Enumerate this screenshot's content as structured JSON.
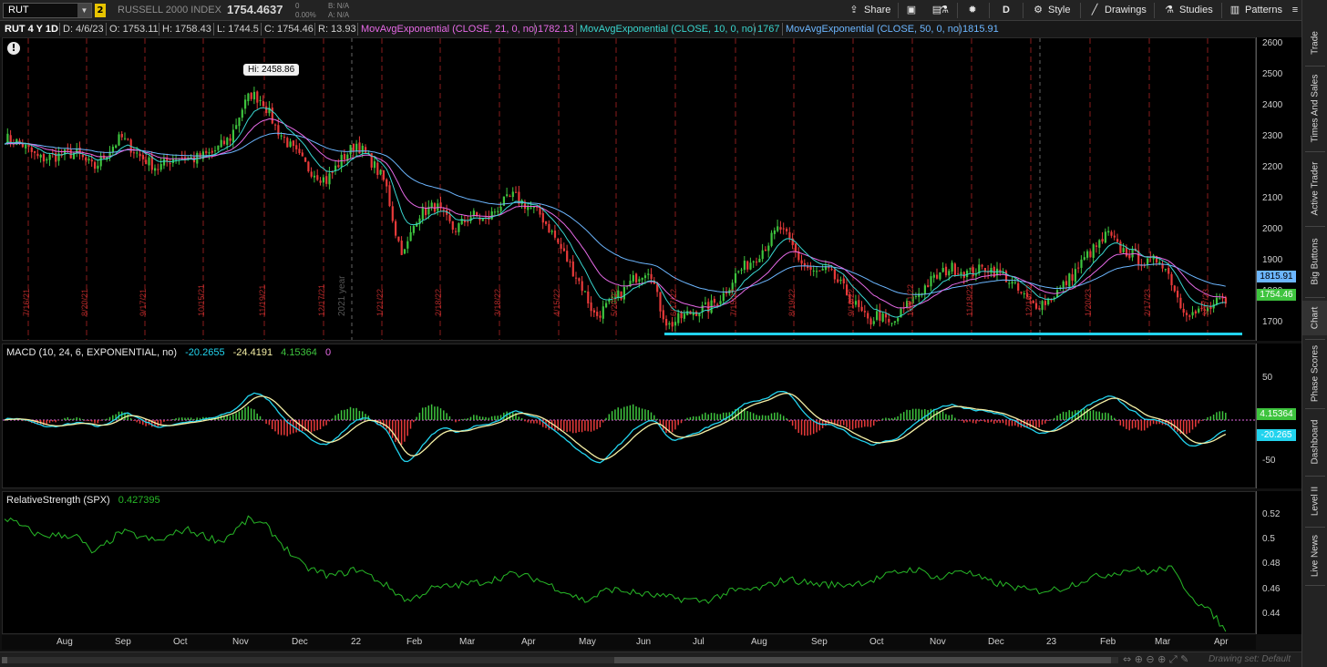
{
  "colors": {
    "background": "#000000",
    "up_candle": "#3ec43e",
    "down_candle": "#e83a3a",
    "ema21": "#e76ae7",
    "ema10": "#39d6cf",
    "ema50": "#6cb6ff",
    "support_line": "#22d3ee",
    "macd_line": "#22d3ee",
    "signal_line": "#f5f0a6",
    "rs_line": "#27b827"
  },
  "toolbar": {
    "symbol": "RUT",
    "link_badge": "2",
    "description": "RUSSELL 2000 INDEX",
    "last_price": "1754.4637",
    "change": "0",
    "change_pct": "0.00%",
    "bid": "B: N/A",
    "ask": "A: N/A",
    "share_label": "Share",
    "timeframe_label": "D",
    "style_label": "Style",
    "drawings_label": "Drawings",
    "studies_label": "Studies",
    "patterns_label": "Patterns"
  },
  "header": {
    "instrument": "RUT 4 Y 1D",
    "date": "D: 4/6/23",
    "open": "O: 1753.11",
    "high": "H: 1758.43",
    "low": "L: 1744.5",
    "close": "C: 1754.46",
    "range": "R: 13.93",
    "ema21_label": "MovAvgExponential (CLOSE, 21, 0, no)",
    "ema21_value": "1782.13",
    "ema10_label": "MovAvgExponential (CLOSE, 10, 0, no)",
    "ema10_value": "1767",
    "ema50_label": "MovAvgExponential (CLOSE, 50, 0, no)",
    "ema50_value": "1815.91"
  },
  "price_axis": {
    "ticks": [
      "2600",
      "2500",
      "2400",
      "2300",
      "2200",
      "2100",
      "2000",
      "1900",
      "1800",
      "1700"
    ],
    "tag_ema50": "1815.91",
    "tag_close": "1754.46"
  },
  "annotations": {
    "hi_label": "Hi: 2458.86",
    "year_label": "2021 year",
    "event_dates": [
      "7/16/21",
      "8/20/21",
      "9/17/21",
      "10/15/21",
      "11/19/21",
      "12/17/21",
      "1/21/22",
      "2/18/22",
      "3/18/22",
      "4/15/22",
      "5/20/22",
      "6/17/22",
      "7/15/22",
      "8/19/22",
      "9/16/22",
      "10/21/22",
      "11/18/22",
      "12/16/22",
      "1/20/23",
      "2/17/23",
      "3/17/23"
    ]
  },
  "macd": {
    "title": "MACD (10, 24, 6, EXPONENTIAL, no)",
    "value": "-20.2655",
    "avg": "-24.4191",
    "diff": "4.15364",
    "zero": "0",
    "ticks": [
      "50",
      "-50"
    ],
    "tag_diff": "4.15364",
    "tag_value": "-20.265"
  },
  "rs": {
    "title": "RelativeStrength (SPX)",
    "value": "0.427395",
    "ticks": [
      "0.52",
      "0.5",
      "0.48",
      "0.46",
      "0.44"
    ]
  },
  "x_axis": {
    "labels": [
      "Aug",
      "Sep",
      "Oct",
      "Nov",
      "Dec",
      "22",
      "Feb",
      "Mar",
      "Apr",
      "May",
      "Jun",
      "Jul",
      "Aug",
      "Sep",
      "Oct",
      "Nov",
      "Dec",
      "23",
      "Feb",
      "Mar",
      "Apr"
    ]
  },
  "bottom": {
    "drawing_set": "Drawing set: Default"
  },
  "sidebar": {
    "items": [
      "Trade",
      "Times And Sales",
      "Active Trader",
      "Big Buttons",
      "Chart",
      "Phase Scores",
      "Dashboard",
      "Level II",
      "Live News"
    ]
  },
  "chart_data": {
    "type": "candlestick",
    "symbol": "RUT",
    "ylim": [
      1640,
      2620
    ],
    "support_level": 1665,
    "series_path": [
      [
        0,
        2300
      ],
      [
        20,
        2280
      ],
      [
        40,
        2230
      ],
      [
        60,
        2240
      ],
      [
        80,
        2250
      ],
      [
        100,
        2200
      ],
      [
        120,
        2270
      ],
      [
        130,
        2300
      ],
      [
        150,
        2240
      ],
      [
        170,
        2200
      ],
      [
        190,
        2240
      ],
      [
        210,
        2230
      ],
      [
        230,
        2250
      ],
      [
        250,
        2300
      ],
      [
        262,
        2390
      ],
      [
        272,
        2440
      ],
      [
        285,
        2420
      ],
      [
        300,
        2330
      ],
      [
        318,
        2260
      ],
      [
        335,
        2200
      ],
      [
        355,
        2160
      ],
      [
        372,
        2230
      ],
      [
        388,
        2280
      ],
      [
        405,
        2220
      ],
      [
        420,
        2150
      ],
      [
        432,
        1980
      ],
      [
        440,
        1920
      ],
      [
        455,
        2050
      ],
      [
        475,
        2080
      ],
      [
        495,
        2000
      ],
      [
        515,
        2050
      ],
      [
        530,
        2030
      ],
      [
        545,
        2080
      ],
      [
        560,
        2110
      ],
      [
        575,
        2080
      ],
      [
        590,
        2050
      ],
      [
        605,
        1980
      ],
      [
        620,
        1900
      ],
      [
        635,
        1820
      ],
      [
        650,
        1720
      ],
      [
        665,
        1760
      ],
      [
        680,
        1800
      ],
      [
        695,
        1850
      ],
      [
        710,
        1880
      ],
      [
        720,
        1760
      ],
      [
        730,
        1690
      ],
      [
        745,
        1720
      ],
      [
        760,
        1740
      ],
      [
        775,
        1750
      ],
      [
        790,
        1790
      ],
      [
        805,
        1860
      ],
      [
        825,
        1910
      ],
      [
        840,
        1960
      ],
      [
        852,
        2010
      ],
      [
        862,
        1970
      ],
      [
        875,
        1900
      ],
      [
        890,
        1860
      ],
      [
        905,
        1870
      ],
      [
        920,
        1820
      ],
      [
        935,
        1760
      ],
      [
        950,
        1700
      ],
      [
        960,
        1730
      ],
      [
        975,
        1690
      ],
      [
        990,
        1750
      ],
      [
        1005,
        1800
      ],
      [
        1020,
        1840
      ],
      [
        1040,
        1880
      ],
      [
        1060,
        1860
      ],
      [
        1080,
        1880
      ],
      [
        1100,
        1850
      ],
      [
        1115,
        1800
      ],
      [
        1130,
        1760
      ],
      [
        1145,
        1770
      ],
      [
        1160,
        1810
      ],
      [
        1175,
        1860
      ],
      [
        1190,
        1920
      ],
      [
        1205,
        1960
      ],
      [
        1212,
        1990
      ],
      [
        1225,
        1940
      ],
      [
        1240,
        1920
      ],
      [
        1255,
        1890
      ],
      [
        1270,
        1910
      ],
      [
        1282,
        1840
      ],
      [
        1292,
        1760
      ],
      [
        1305,
        1730
      ],
      [
        1320,
        1740
      ],
      [
        1335,
        1770
      ],
      [
        1342,
        1754
      ]
    ]
  }
}
